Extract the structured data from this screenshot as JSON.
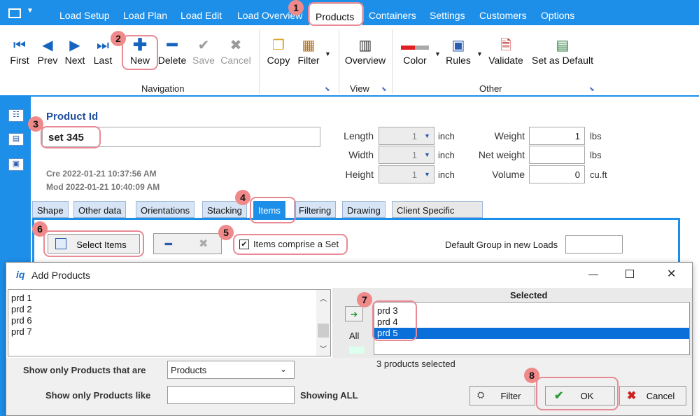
{
  "menu": {
    "app_menu_icon": "app-menu-icon",
    "items": [
      "Load Setup",
      "Load Plan",
      "Load Edit",
      "Load Overview",
      "Products",
      "Containers",
      "Settings",
      "Customers",
      "Options"
    ]
  },
  "ribbon": {
    "navigation": {
      "first": "First",
      "prev": "Prev",
      "next": "Next",
      "last": "Last",
      "new": "New",
      "delete": "Delete",
      "save": "Save",
      "cancel": "Cancel",
      "copy": "Copy",
      "filter": "Filter",
      "label": "Navigation"
    },
    "view": {
      "overview": "Overview",
      "label": "View"
    },
    "other": {
      "color": "Color",
      "rules": "Rules",
      "validate": "Validate",
      "set_default": "Set as Default",
      "label": "Other"
    }
  },
  "product": {
    "id_label": "Product Id",
    "id_value": "set 345",
    "created": "Cre 2022-01-21 10:37:56 AM",
    "modified": "Mod 2022-01-21 10:40:09 AM",
    "length_label": "Length",
    "length_value": "1",
    "length_unit": "inch",
    "width_label": "Width",
    "width_value": "1",
    "width_unit": "inch",
    "height_label": "Height",
    "height_value": "1",
    "height_unit": "inch",
    "weight_label": "Weight",
    "weight_value": "1",
    "weight_unit": "lbs",
    "netweight_label": "Net weight",
    "netweight_value": "",
    "netweight_unit": "lbs",
    "volume_label": "Volume",
    "volume_value": "0",
    "volume_unit": "cu.ft"
  },
  "tabs": [
    "Shape",
    "Other data",
    "Orientations",
    "Stacking",
    "Items",
    "Filtering",
    "Drawing",
    "Client Specific"
  ],
  "items_tab": {
    "select_items": "Select Items",
    "comprise_set": "Items comprise a Set",
    "comprise_checked": true,
    "default_group_label": "Default Group in new Loads",
    "default_group_value": ""
  },
  "dialog": {
    "title": "Add Products",
    "available": [
      "prd 1",
      "prd 2",
      "prd 6",
      "prd 7"
    ],
    "selected_header": "Selected",
    "selected": [
      "prd 3",
      "prd 4",
      "prd 5"
    ],
    "highlighted": "prd 5",
    "all_label": "All",
    "selected_count": "3 products selected",
    "show_only_label": "Show only Products that are",
    "show_only_value": "Products",
    "show_like_label": "Show only Products like",
    "show_like_value": "",
    "showing": "Showing ALL",
    "filter_btn": "Filter",
    "ok_btn": "OK",
    "cancel_btn": "Cancel"
  },
  "callouts": [
    "1",
    "2",
    "3",
    "4",
    "5",
    "6",
    "7",
    "8"
  ]
}
